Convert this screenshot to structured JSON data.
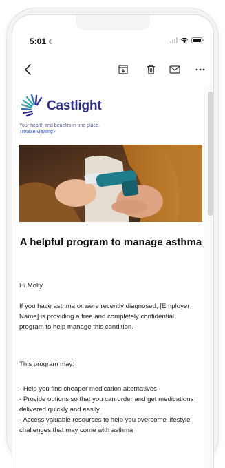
{
  "status_bar": {
    "time": "5:01"
  },
  "toolbar": {
    "back_icon": "chevron-left-icon",
    "archive_icon": "archive-icon",
    "delete_icon": "trash-icon",
    "mail_icon": "envelope-icon",
    "more_icon": "more-horizontal-icon"
  },
  "email": {
    "brand": "Castlight",
    "tagline": "Your health and benefits in one place.",
    "trouble_link": "Trouble viewing?",
    "headline": "A helpful program to manage asthma",
    "greeting": "Hi Molly,",
    "intro": "If you have asthma or were recently diagnosed, [Employer Name] is providing a free and completely confidential program to help manage this condition.",
    "list_intro": "This program may:",
    "bullets": [
      "- Help you find cheaper medication alternatives",
      "- Provide options so that you can order and get medications delivered quickly and easily",
      "- Access valuable resources to help you overcome lifestyle challenges that may come with asthma"
    ]
  },
  "colors": {
    "brand": "#2e2f8a",
    "link": "#2a4fd0",
    "logo_teal": "#3aa6b0"
  }
}
